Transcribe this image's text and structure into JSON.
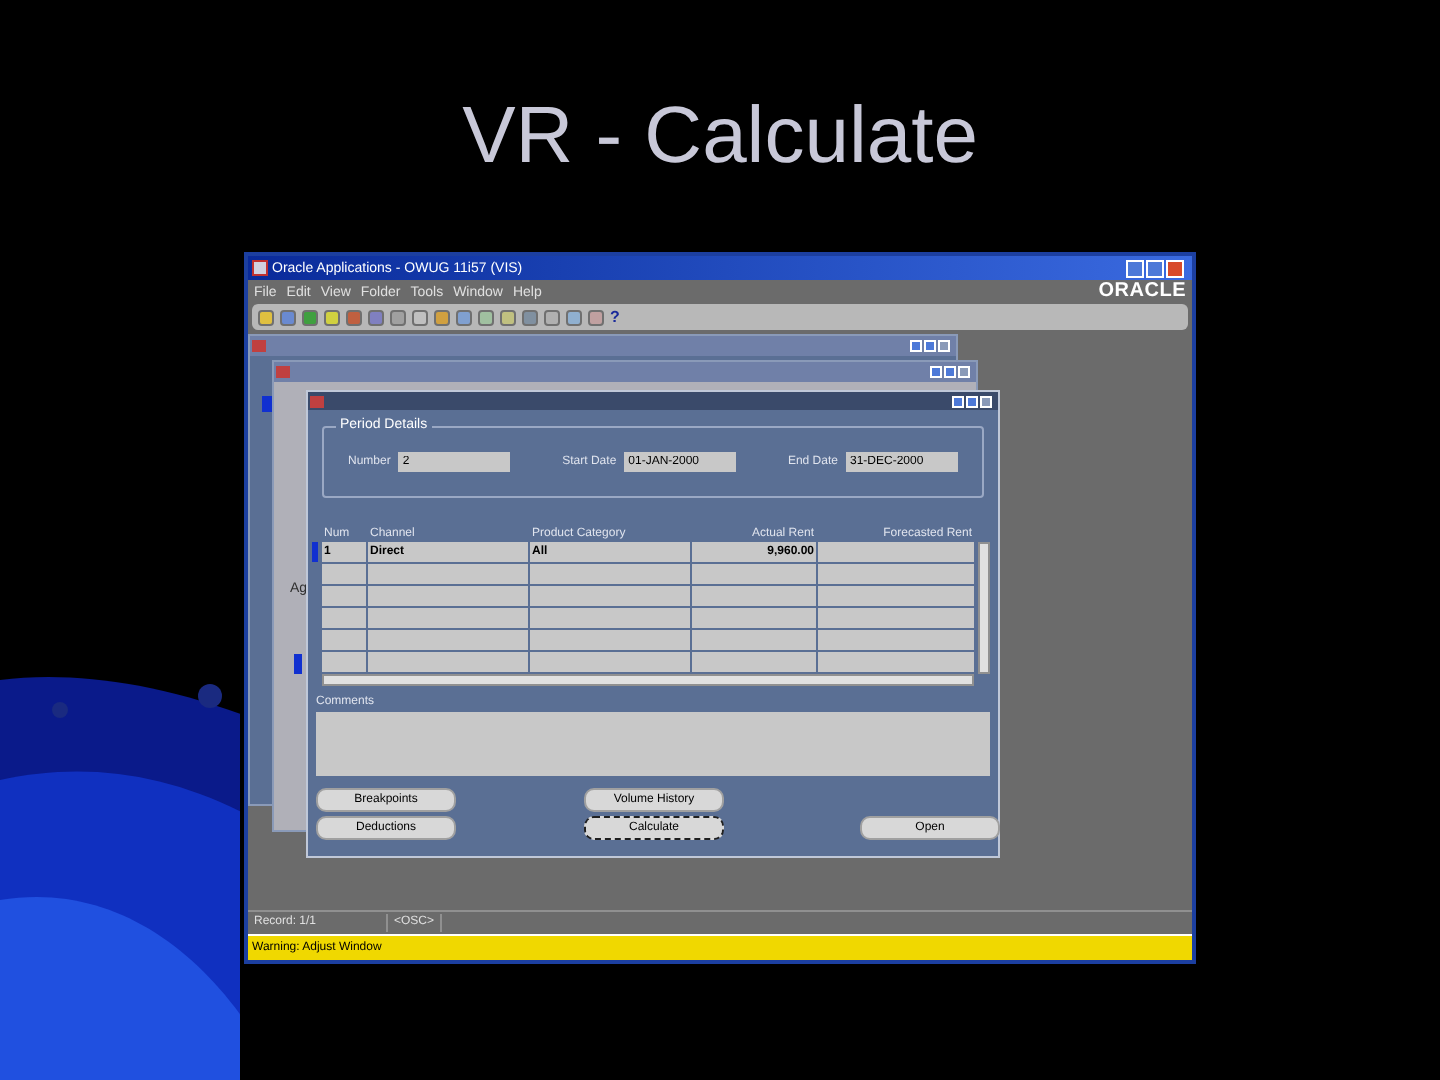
{
  "slide": {
    "title": "VR - Calculate"
  },
  "window": {
    "title": "Oracle Applications - OWUG 11i57 (VIS)",
    "logo": "ORACLE"
  },
  "menu": [
    "File",
    "Edit",
    "View",
    "Folder",
    "Tools",
    "Window",
    "Help"
  ],
  "toolbar": {
    "help": "?"
  },
  "back_window": {
    "side_label": "Ag"
  },
  "form": {
    "group": "Period Details",
    "fields": [
      {
        "label": "Number",
        "value": "2"
      },
      {
        "label": "Start Date",
        "value": "01-JAN-2000"
      },
      {
        "label": "End Date",
        "value": "31-DEC-2000"
      }
    ],
    "table": {
      "columns": [
        "Num",
        "Channel",
        "Product Category",
        "Actual Rent",
        "Forecasted Rent"
      ],
      "rows": [
        {
          "cells": [
            "1",
            "Direct",
            "All",
            "9,960.00"
          ],
          "selected": true
        }
      ]
    },
    "comments": {
      "label": "Comments"
    },
    "button_rows": [
      [
        {
          "label": "Breakpoints",
          "focused": false
        },
        {
          "label": "Volume History",
          "focused": false
        }
      ],
      [
        {
          "label": "Deductions",
          "focused": false
        },
        {
          "label": "Calculate",
          "focused": true
        },
        {
          "label": "Open",
          "focused": false
        }
      ]
    ]
  },
  "status_bar": [
    "Record: 1/1",
    "<OSC>"
  ],
  "message": "Warning: Adjust Window"
}
